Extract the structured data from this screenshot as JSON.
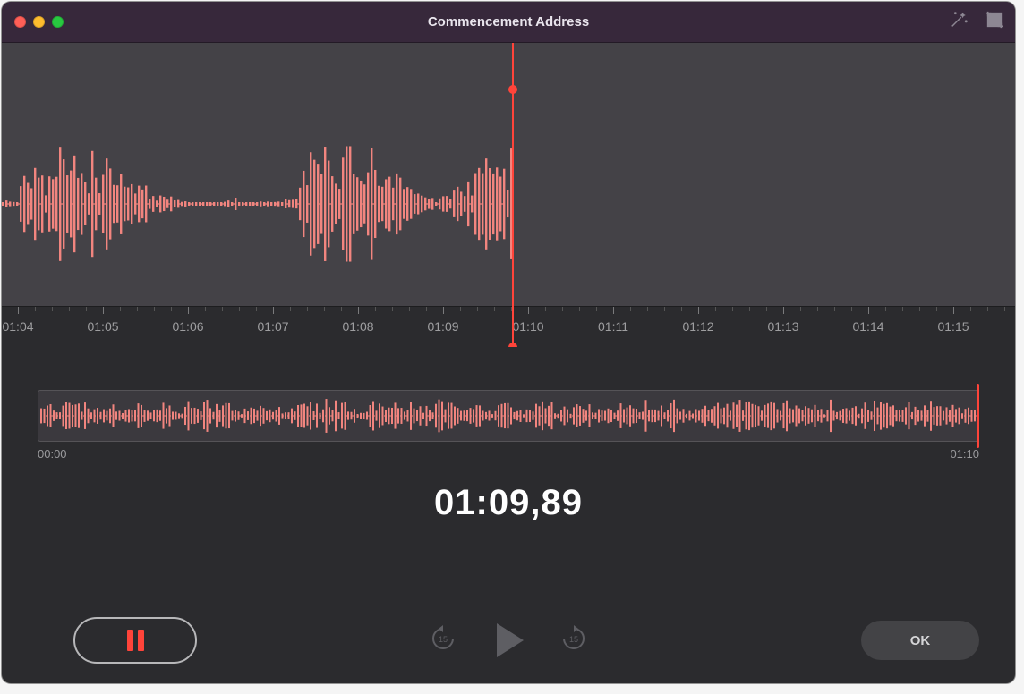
{
  "window": {
    "title": "Commencement Address"
  },
  "ruler": {
    "ticks": [
      "01:04",
      "01:05",
      "01:06",
      "01:07",
      "01:08",
      "01:09",
      "01:10",
      "01:11",
      "01:12",
      "01:13",
      "01:14",
      "01:15"
    ]
  },
  "overall": {
    "start_label": "00:00",
    "end_label": "01:10"
  },
  "time": {
    "current": "01:09,89"
  },
  "controls": {
    "ok_label": "OK",
    "skip_back_amount": "15",
    "skip_fwd_amount": "15"
  },
  "icons": {
    "enhance": "enhance-icon",
    "trim": "trim-icon"
  },
  "colors": {
    "accent": "#ff443a"
  }
}
